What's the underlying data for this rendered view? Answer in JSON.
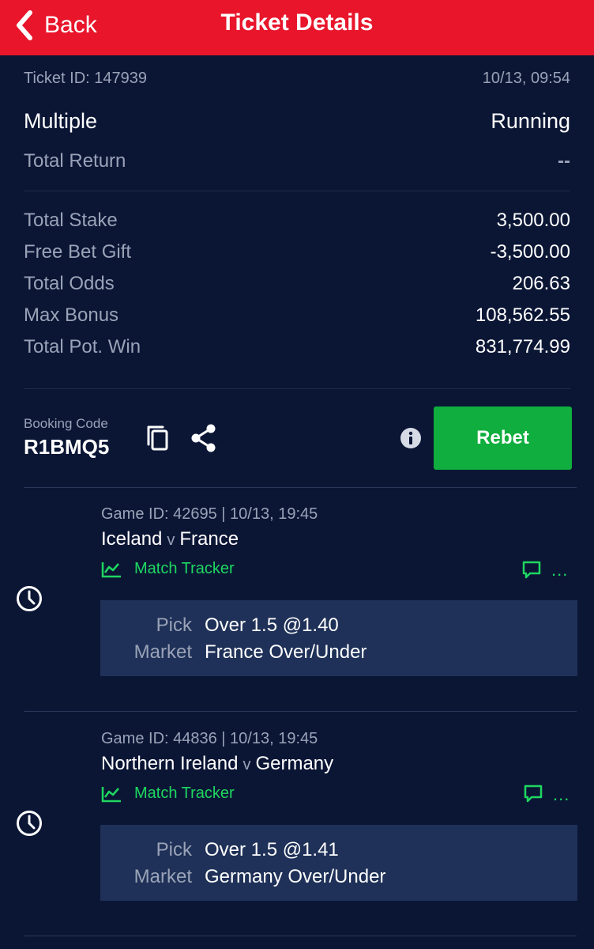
{
  "header": {
    "back_label": "Back",
    "title": "Ticket Details"
  },
  "ticket": {
    "id_label": "Ticket ID: 147939",
    "datetime": "10/13, 09:54",
    "type": "Multiple",
    "status": "Running",
    "total_return_label": "Total Return",
    "total_return_value": "--"
  },
  "stats": [
    {
      "label": "Total Stake",
      "value": "3,500.00"
    },
    {
      "label": "Free Bet Gift",
      "value": "-3,500.00"
    },
    {
      "label": "Total Odds",
      "value": "206.63"
    },
    {
      "label": "Max Bonus",
      "value": "108,562.55"
    },
    {
      "label": "Total Pot. Win",
      "value": "831,774.99"
    }
  ],
  "booking": {
    "label": "Booking Code",
    "code": "R1BMQ5",
    "rebet_label": "Rebet"
  },
  "games": [
    {
      "meta": "Game ID: 42695 | 10/13, 19:45",
      "home": "Iceland",
      "vs": "v",
      "away": "France",
      "tracker_label": "Match Tracker",
      "more": "...",
      "pick_key": "Pick",
      "pick_value": "Over 1.5 @1.40",
      "market_key": "Market",
      "market_value": "France Over/Under"
    },
    {
      "meta": "Game ID: 44836 | 10/13, 19:45",
      "home": "Northern Ireland",
      "vs": "v",
      "away": "Germany",
      "tracker_label": "Match Tracker",
      "more": "...",
      "pick_key": "Pick",
      "pick_value": "Over 1.5 @1.41",
      "market_key": "Market",
      "market_value": "Germany Over/Under"
    }
  ],
  "colors": {
    "header": "#e8152b",
    "background": "#0b1635",
    "accent_green": "#1ed760",
    "rebet": "#0fae3e",
    "pick_box": "#1f3158"
  }
}
